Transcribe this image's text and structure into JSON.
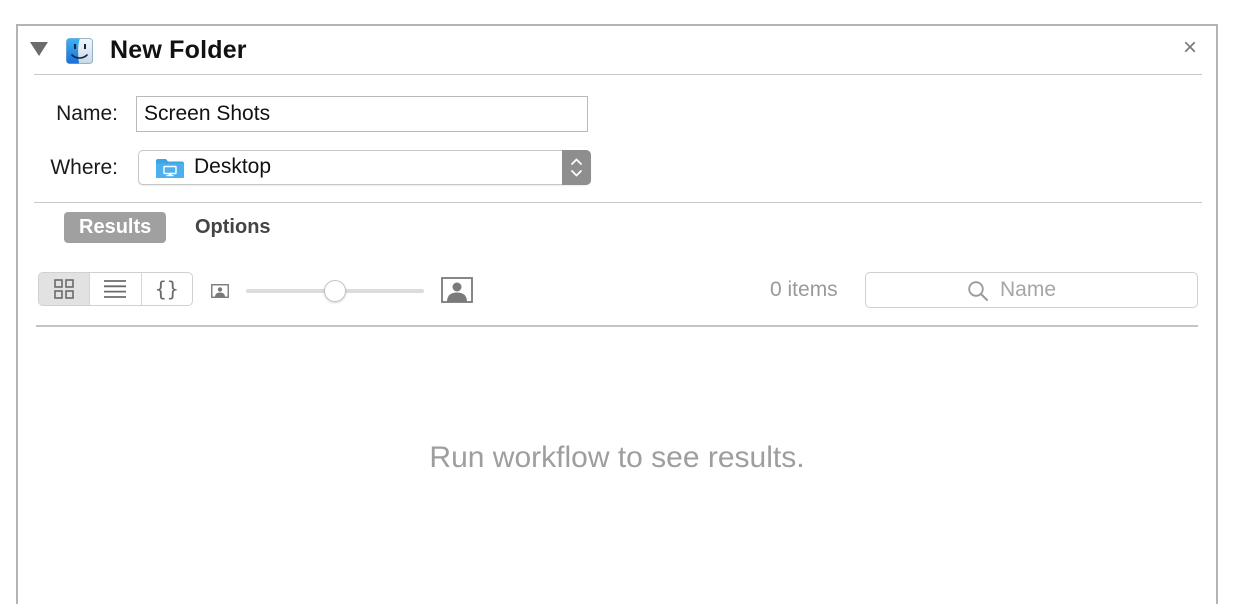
{
  "header": {
    "title": "New Folder",
    "collapse_icon": "disclosure-triangle-icon",
    "app_icon": "finder-icon",
    "close_label": "×"
  },
  "form": {
    "name_label": "Name:",
    "name_value": "Screen Shots",
    "where_label": "Where:",
    "where_value": "Desktop",
    "where_icon": "desktop-folder-icon"
  },
  "tabs": [
    {
      "label": "Results",
      "selected": true
    },
    {
      "label": "Options",
      "selected": false
    }
  ],
  "toolbar": {
    "view_modes": [
      {
        "icon": "icon-view-icon",
        "selected": true
      },
      {
        "icon": "list-view-icon",
        "selected": false
      },
      {
        "icon": "json-view-icon",
        "label": "{}",
        "selected": false
      }
    ],
    "thumbnail_size_fraction": 0.5,
    "item_count": "0 items",
    "search_placeholder": "Name"
  },
  "results": {
    "empty_message": "Run workflow to see results."
  },
  "colors": {
    "tab_selected_bg": "#a0a0a0",
    "desktop_folder_blue": "#3ba4e6",
    "stepper_gray": "#8e8e8e"
  }
}
